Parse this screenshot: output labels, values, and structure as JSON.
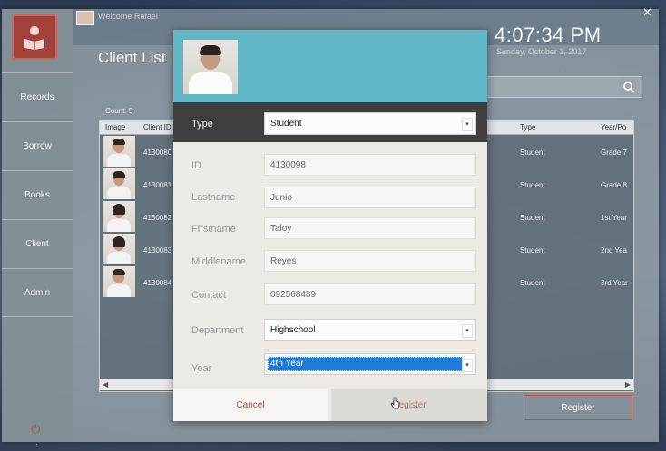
{
  "window": {
    "welcome": "Welcome Rafael",
    "close_icon": "close-icon",
    "time": "4:07:34 PM",
    "date": "Sunday, October 1, 2017"
  },
  "sidebar": {
    "logo_icon": "reader-book-icon",
    "items": [
      {
        "label": "Records"
      },
      {
        "label": "Borrow"
      },
      {
        "label": "Books"
      },
      {
        "label": "Client"
      },
      {
        "label": "Admin"
      }
    ],
    "power_icon": "power-icon"
  },
  "main": {
    "title": "Client List",
    "count": "Count: 5",
    "columns": [
      "Image",
      "Client ID",
      "Type",
      "Year/Po"
    ],
    "rows": [
      {
        "client_id": "4130080",
        "type": "Student",
        "year": "Grade 7"
      },
      {
        "client_id": "4130081",
        "type": "Student",
        "year": "Grade 8"
      },
      {
        "client_id": "4130082",
        "type": "Student",
        "year": "1st Year"
      },
      {
        "client_id": "4130083",
        "type": "Student",
        "year": "2nd Yea"
      },
      {
        "client_id": "4130084",
        "type": "Student",
        "year": "3rd Year"
      }
    ],
    "register_label": "Register"
  },
  "modal": {
    "type_label": "Type",
    "type_value": "Student",
    "fields": {
      "id": {
        "label": "ID",
        "value": "4130098"
      },
      "lastname": {
        "label": "Lastname",
        "value": "Junio"
      },
      "firstname": {
        "label": "Firstname",
        "value": "Taloy"
      },
      "middlename": {
        "label": "Middlename",
        "value": "Reyes"
      },
      "contact": {
        "label": "Contact",
        "value": "092568489"
      }
    },
    "department_label": "Department",
    "department_value": "Highschool",
    "year_label": "Year",
    "year_value": "4th Year",
    "cancel_label": "Cancel",
    "register_label": "Register"
  }
}
